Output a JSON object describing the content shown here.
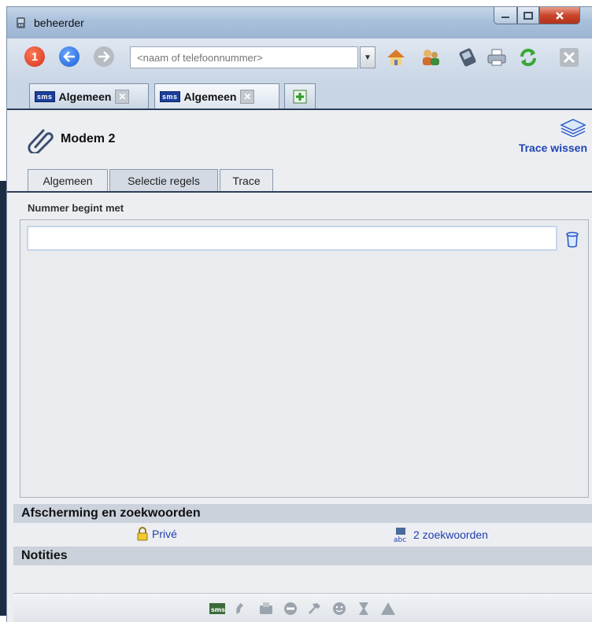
{
  "window": {
    "title": "beheerder"
  },
  "toolbar": {
    "search_placeholder": "<naam of telefoonnummer>",
    "buttons": [
      "alert-icon",
      "back-icon",
      "forward-icon",
      "home-icon",
      "users-icon",
      "phone-book-icon",
      "print-icon",
      "refresh-icon",
      "close-icon"
    ]
  },
  "doc_tabs": [
    {
      "badge": "sms",
      "label": "Algemeen"
    },
    {
      "badge": "sms",
      "label": "Algemeen"
    }
  ],
  "header": {
    "title": "Modem 2",
    "trace_button": "Trace wissen"
  },
  "inner_tabs": [
    "Algemeen",
    "Selectie regels",
    "Trace"
  ],
  "selected_inner_tab": "Selectie regels",
  "panel": {
    "label": "Nummer begint met",
    "value": ""
  },
  "afscherming": {
    "heading": "Afscherming en zoekwoorden",
    "prive_label": "Privé",
    "keywords_label": "2 zoekwoorden"
  },
  "notities": {
    "heading": "Notities"
  },
  "statusbar": {
    "icons": [
      "sms-icon",
      "call-icon",
      "fax-icon",
      "minus-icon",
      "settings-icon",
      "face-icon",
      "hourglass-icon",
      "warning-icon"
    ]
  },
  "colors": {
    "accent_link": "#1f45b5",
    "bar_bg": "#cbd2dc",
    "titlebar": "#a9c0dc"
  }
}
